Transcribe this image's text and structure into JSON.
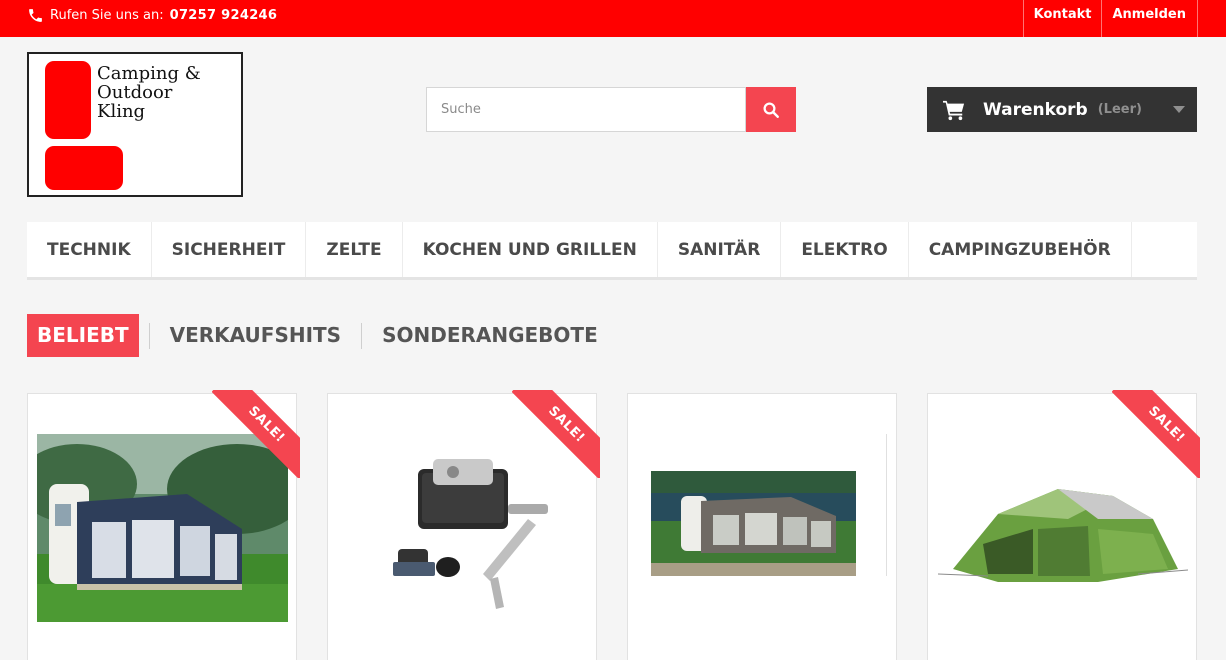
{
  "topbar": {
    "phone_prefix": "Rufen Sie uns an:",
    "phone_number": "07257 924246",
    "links": [
      "Kontakt",
      "Anmelden"
    ]
  },
  "logo": {
    "text": "Camping &\nOutdoor\nKling"
  },
  "search": {
    "placeholder": "Suche"
  },
  "cart": {
    "label": "Warenkorb",
    "status": "(Leer)"
  },
  "menu": [
    "TECHNIK",
    "SICHERHEIT",
    "ZELTE",
    "KOCHEN UND GRILLEN",
    "SANITÄR",
    "ELEKTRO",
    "CAMPINGZUBEHÖR"
  ],
  "tabs": {
    "items": [
      "BELIEBT",
      "VERKAUFSHITS",
      "SONDERANGEBOTE"
    ],
    "active": "BELIEBT"
  },
  "products": [
    {
      "badge": "SALE!",
      "image": "awning-caravan-image"
    },
    {
      "badge": "SALE!",
      "image": "caravan-mover-image"
    },
    {
      "badge": "",
      "image": "caravan-awning-lake-image"
    },
    {
      "badge": "SALE!",
      "image": "green-tunnel-tent-image"
    }
  ],
  "colors": {
    "topbar": "#ff0000",
    "accent": "#f44550",
    "cart": "#333333",
    "background": "#f5f5f5"
  },
  "icons": {
    "phone": "phone-icon",
    "search": "search-icon",
    "cart": "cart-icon"
  }
}
